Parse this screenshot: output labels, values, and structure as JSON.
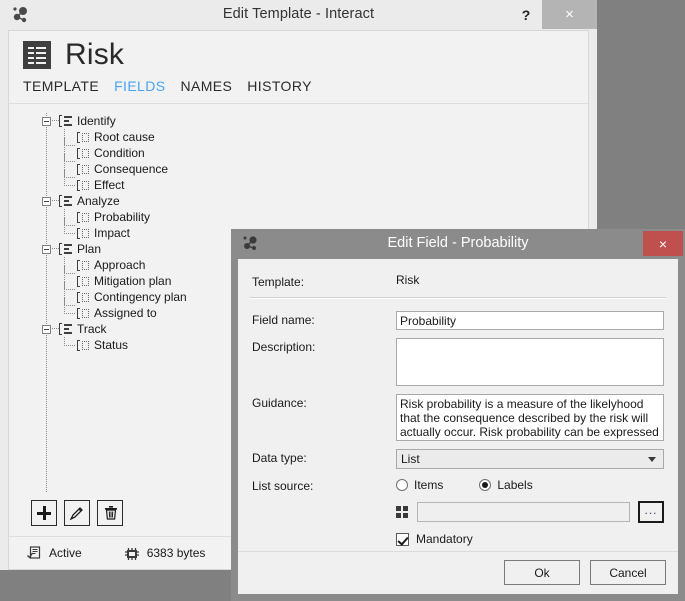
{
  "main_window": {
    "title": "Edit Template - Interact",
    "app_icon": "molecule-icon",
    "help_label": "?",
    "close_label": "×",
    "page_title": "Risk",
    "template_icon": "form-template-icon",
    "tabs": [
      {
        "label": "TEMPLATE",
        "active": false
      },
      {
        "label": "FIELDS",
        "active": true
      },
      {
        "label": "NAMES",
        "active": false
      },
      {
        "label": "HISTORY",
        "active": false
      }
    ],
    "tree": [
      {
        "label": "Identify",
        "type": "group",
        "expanded": true
      },
      {
        "label": "Root cause",
        "type": "field"
      },
      {
        "label": "Condition",
        "type": "field"
      },
      {
        "label": "Consequence",
        "type": "field"
      },
      {
        "label": "Effect",
        "type": "field"
      },
      {
        "label": "Analyze",
        "type": "group",
        "expanded": true
      },
      {
        "label": "Probability",
        "type": "field"
      },
      {
        "label": "Impact",
        "type": "field"
      },
      {
        "label": "Plan",
        "type": "group",
        "expanded": true
      },
      {
        "label": "Approach",
        "type": "field"
      },
      {
        "label": "Mitigation plan",
        "type": "field"
      },
      {
        "label": "Contingency plan",
        "type": "field"
      },
      {
        "label": "Assigned to",
        "type": "field"
      },
      {
        "label": "Track",
        "type": "group",
        "expanded": true
      },
      {
        "label": "Status",
        "type": "field"
      }
    ],
    "toolbar": {
      "add_label": "add-field-button",
      "edit_label": "edit-field-button",
      "delete_label": "delete-field-button"
    },
    "status_bar": {
      "state_icon": "document-state-icon",
      "state_text": "Active",
      "size_icon": "memory-chip-icon",
      "size_text": "6383 bytes"
    }
  },
  "dialog": {
    "title": "Edit Field - Probability",
    "app_icon": "molecule-icon",
    "close_label": "×",
    "template_label": "Template:",
    "template_value": "Risk",
    "field_name_label": "Field name:",
    "field_name_value": "Probability",
    "description_label": "Description:",
    "description_value": "",
    "guidance_label": "Guidance:",
    "guidance_value": "Risk probability is a measure of the likelyhood that the consequence described by the risk will actually occur. Risk probability can be expressed as a simple mapping of",
    "data_type_label": "Data type:",
    "data_type_value": "List",
    "list_source_label": "List source:",
    "radio_items_label": "Items",
    "radio_labels_label": "Labels",
    "list_source_selected": "Labels",
    "source_icon": "grid-icon",
    "source_value": "",
    "browse_label": "...",
    "mandatory_label": "Mandatory",
    "mandatory_checked": true,
    "ok_label": "Ok",
    "cancel_label": "Cancel"
  },
  "colors": {
    "window_bg": "#ebebeb",
    "panel_bg": "#f2f2f2",
    "active_tab": "#4aa3f0",
    "dialog_chrome": "#8b8b8b",
    "dialog_close": "#c0504d",
    "main_close": "#b4b4b4",
    "desktop": "#808080"
  }
}
